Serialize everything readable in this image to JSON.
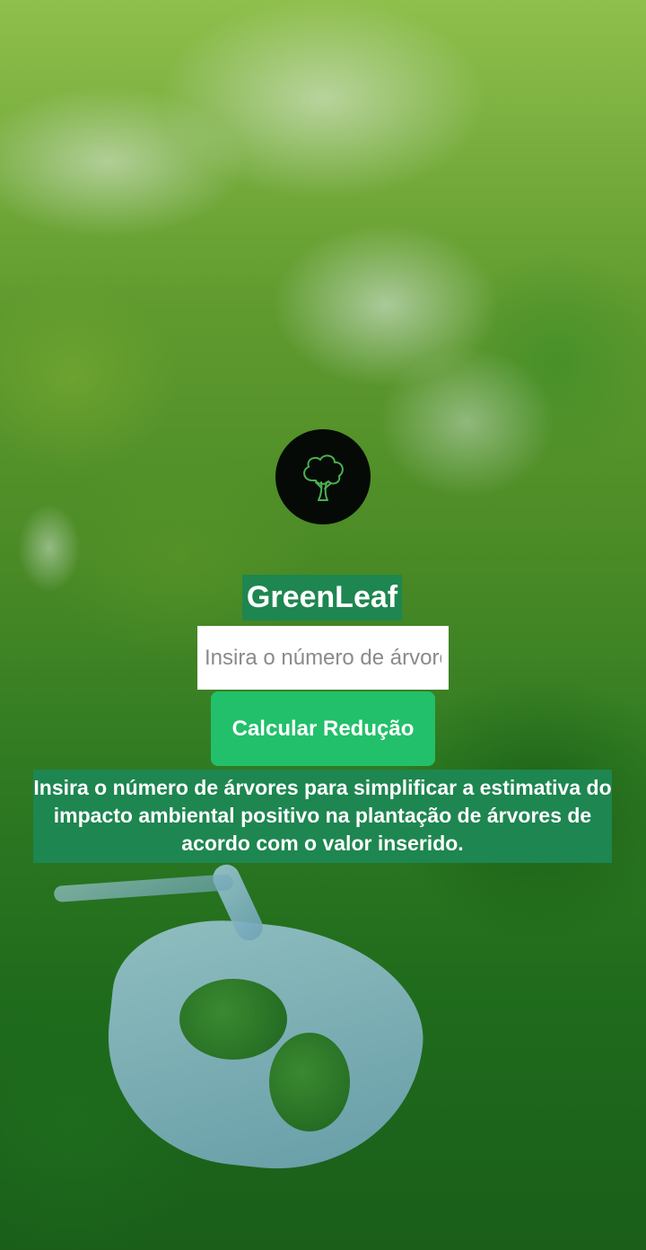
{
  "app": {
    "title": "GreenLeaf",
    "logo_icon": "tree-icon"
  },
  "form": {
    "trees_input": {
      "placeholder": "Insira o número de árvores",
      "value": ""
    },
    "calculate_label": "Calcular Redução"
  },
  "description": "Insira o número de árvores para simplificar a estimativa do impacto ambiental positivo na plantação de árvores de acordo com o valor inserido.",
  "colors": {
    "label_bg": "#1e8650",
    "button_bg": "#22c06a",
    "logo_bg": "#060a06",
    "logo_stroke": "#4caf50"
  }
}
